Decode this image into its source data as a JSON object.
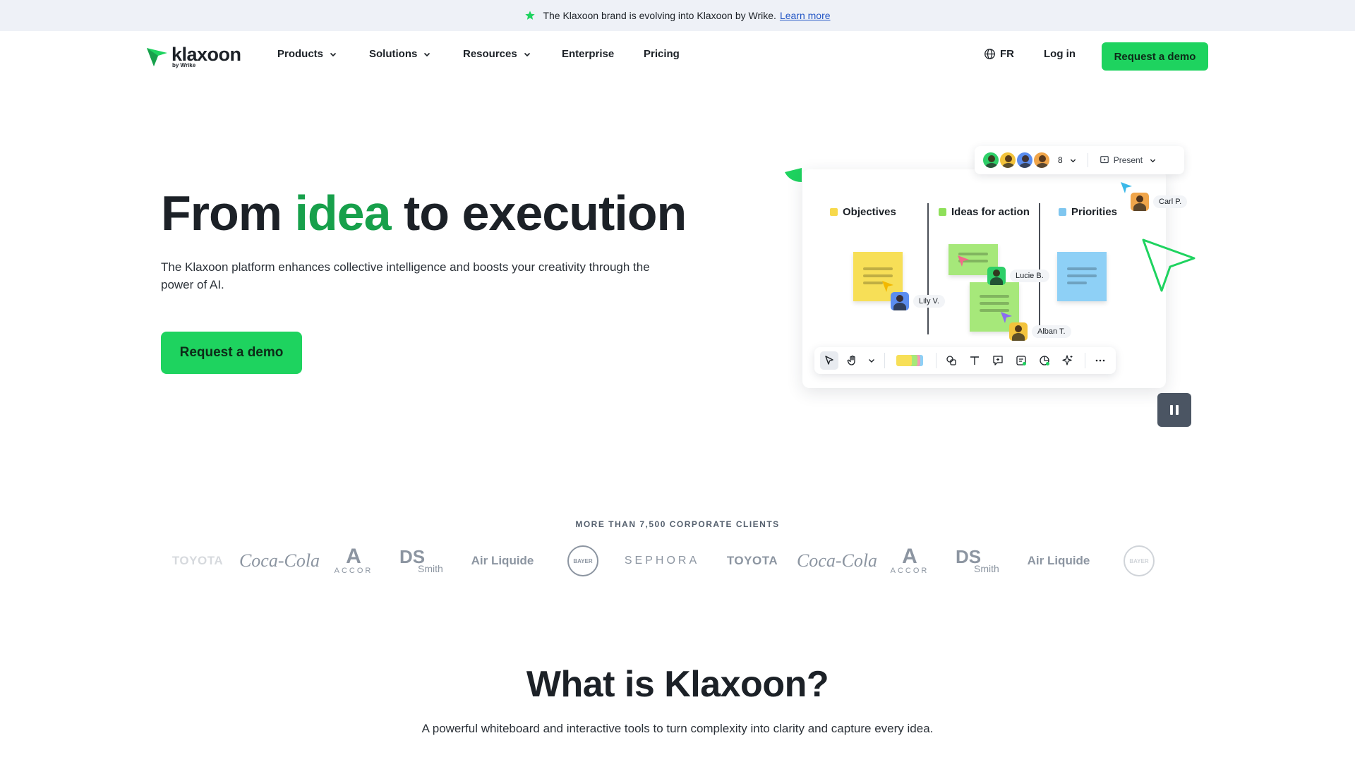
{
  "banner": {
    "icon": "star-icon",
    "text": "The Klaxoon brand is evolving into Klaxoon by Wrike.",
    "link": "Learn more"
  },
  "header": {
    "logo_word": "klaxoon",
    "logo_sub": "by Wrike",
    "nav": [
      {
        "label": "Products",
        "has_dropdown": true
      },
      {
        "label": "Solutions",
        "has_dropdown": true
      },
      {
        "label": "Resources",
        "has_dropdown": true
      },
      {
        "label": "Enterprise",
        "has_dropdown": false
      },
      {
        "label": "Pricing",
        "has_dropdown": false
      }
    ],
    "language": "FR",
    "login": "Log in",
    "cta": "Request a demo"
  },
  "hero": {
    "title_before": "From",
    "title_accent": "idea",
    "title_after": "to execution",
    "subtitle": "The Klaxoon platform enhances collective intelligence and boosts your creativity through the power of AI.",
    "cta": "Request a demo"
  },
  "board": {
    "participant_count": "8",
    "present_label": "Present",
    "columns": [
      {
        "label": "Objectives",
        "color": "#f7d94c"
      },
      {
        "label": "Ideas for action",
        "color": "#8fe05a"
      },
      {
        "label": "Priorities",
        "color": "#7fc6ef"
      }
    ],
    "cursors": [
      {
        "label": "Carl P."
      },
      {
        "label": "Lucie B."
      },
      {
        "label": "Lily V."
      },
      {
        "label": "Alban T."
      }
    ],
    "colors": {
      "yellow_note": "#f7df57",
      "green_note": "#a6e87a",
      "blue_note": "#8ed0f6",
      "accent_green": "#1ed35f"
    }
  },
  "clients": {
    "title": "MORE THAN 7,500 CORPORATE CLIENTS",
    "logos": {
      "toyota": "TOYOTA",
      "coke": "Coca-Cola",
      "accor": "ACCOR",
      "ds_top": "DS",
      "ds_bottom": "Smith",
      "airliquide": "Air Liquide",
      "bayer": "BAYER",
      "sephora": "SEPHORA"
    }
  },
  "what": {
    "title": "What is Klaxoon?",
    "subtitle": "A powerful whiteboard and interactive tools to turn complexity into clarity and capture every idea."
  }
}
